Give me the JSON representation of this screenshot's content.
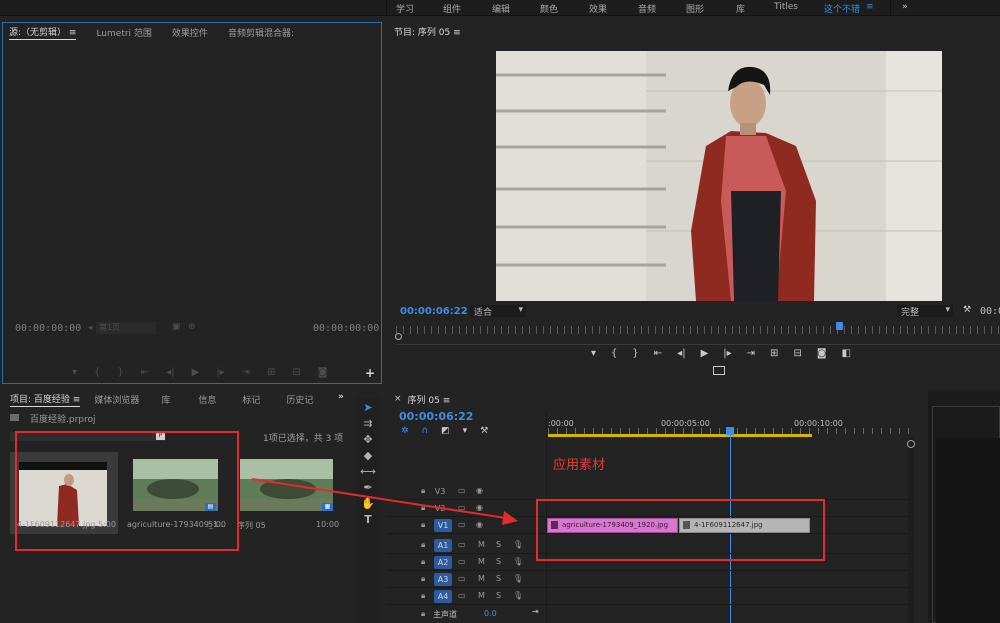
{
  "workspaces": [
    "学习",
    "组件",
    "编辑",
    "颜色",
    "效果",
    "音频",
    "图形",
    "库",
    "Titles",
    "这个不错"
  ],
  "source_panel": {
    "tabs": [
      "源:（无剪辑）",
      "Lumetri 范围",
      "效果控件",
      "音频剪辑混合器:"
    ],
    "timecode_left": "00:00:00:00",
    "timecode_right": "00:00:00:00",
    "zoom": "第1页"
  },
  "program_panel": {
    "title": "节目: 序列 05",
    "timecode": "00:00:06:22",
    "fit": "适合",
    "quality": "完整",
    "timecode_right": "00:00"
  },
  "project_panel": {
    "tabs": [
      "项目: 百度经验",
      "媒体浏览器",
      "库",
      "信息",
      "标记",
      "历史记"
    ],
    "file": "百度经验.prproj",
    "selection": "1项已选择，共 3 项",
    "items": [
      {
        "name": "4-1F609112647.jpg",
        "duration": "5:00"
      },
      {
        "name": "agriculture-1793409_1...",
        "duration": "5:00"
      },
      {
        "name": "序列 05",
        "duration": "10:00"
      }
    ]
  },
  "timeline": {
    "title": "序列 05",
    "timecode": "00:00:06:22",
    "ruler": [
      ":00:00",
      "00:00:05:00",
      "00:00:10:00"
    ],
    "video_tracks": [
      "V3",
      "V2",
      "V1"
    ],
    "audio_tracks": [
      "A1",
      "A2",
      "A3",
      "A4"
    ],
    "master": {
      "label": "主声道",
      "value": "0.0"
    },
    "clips": [
      {
        "name": "agriculture-1793409_1920.jpg",
        "color": "#d877d0"
      },
      {
        "name": "4-1F609112647.jpg",
        "color": "#b5b5b5"
      }
    ],
    "mute_label": "M",
    "solo_label": "S"
  },
  "annotation": "应用素材",
  "colors": {
    "accent": "#3d8de8",
    "annotation_red": "#e32b2b",
    "workarea": "#d4b800"
  }
}
